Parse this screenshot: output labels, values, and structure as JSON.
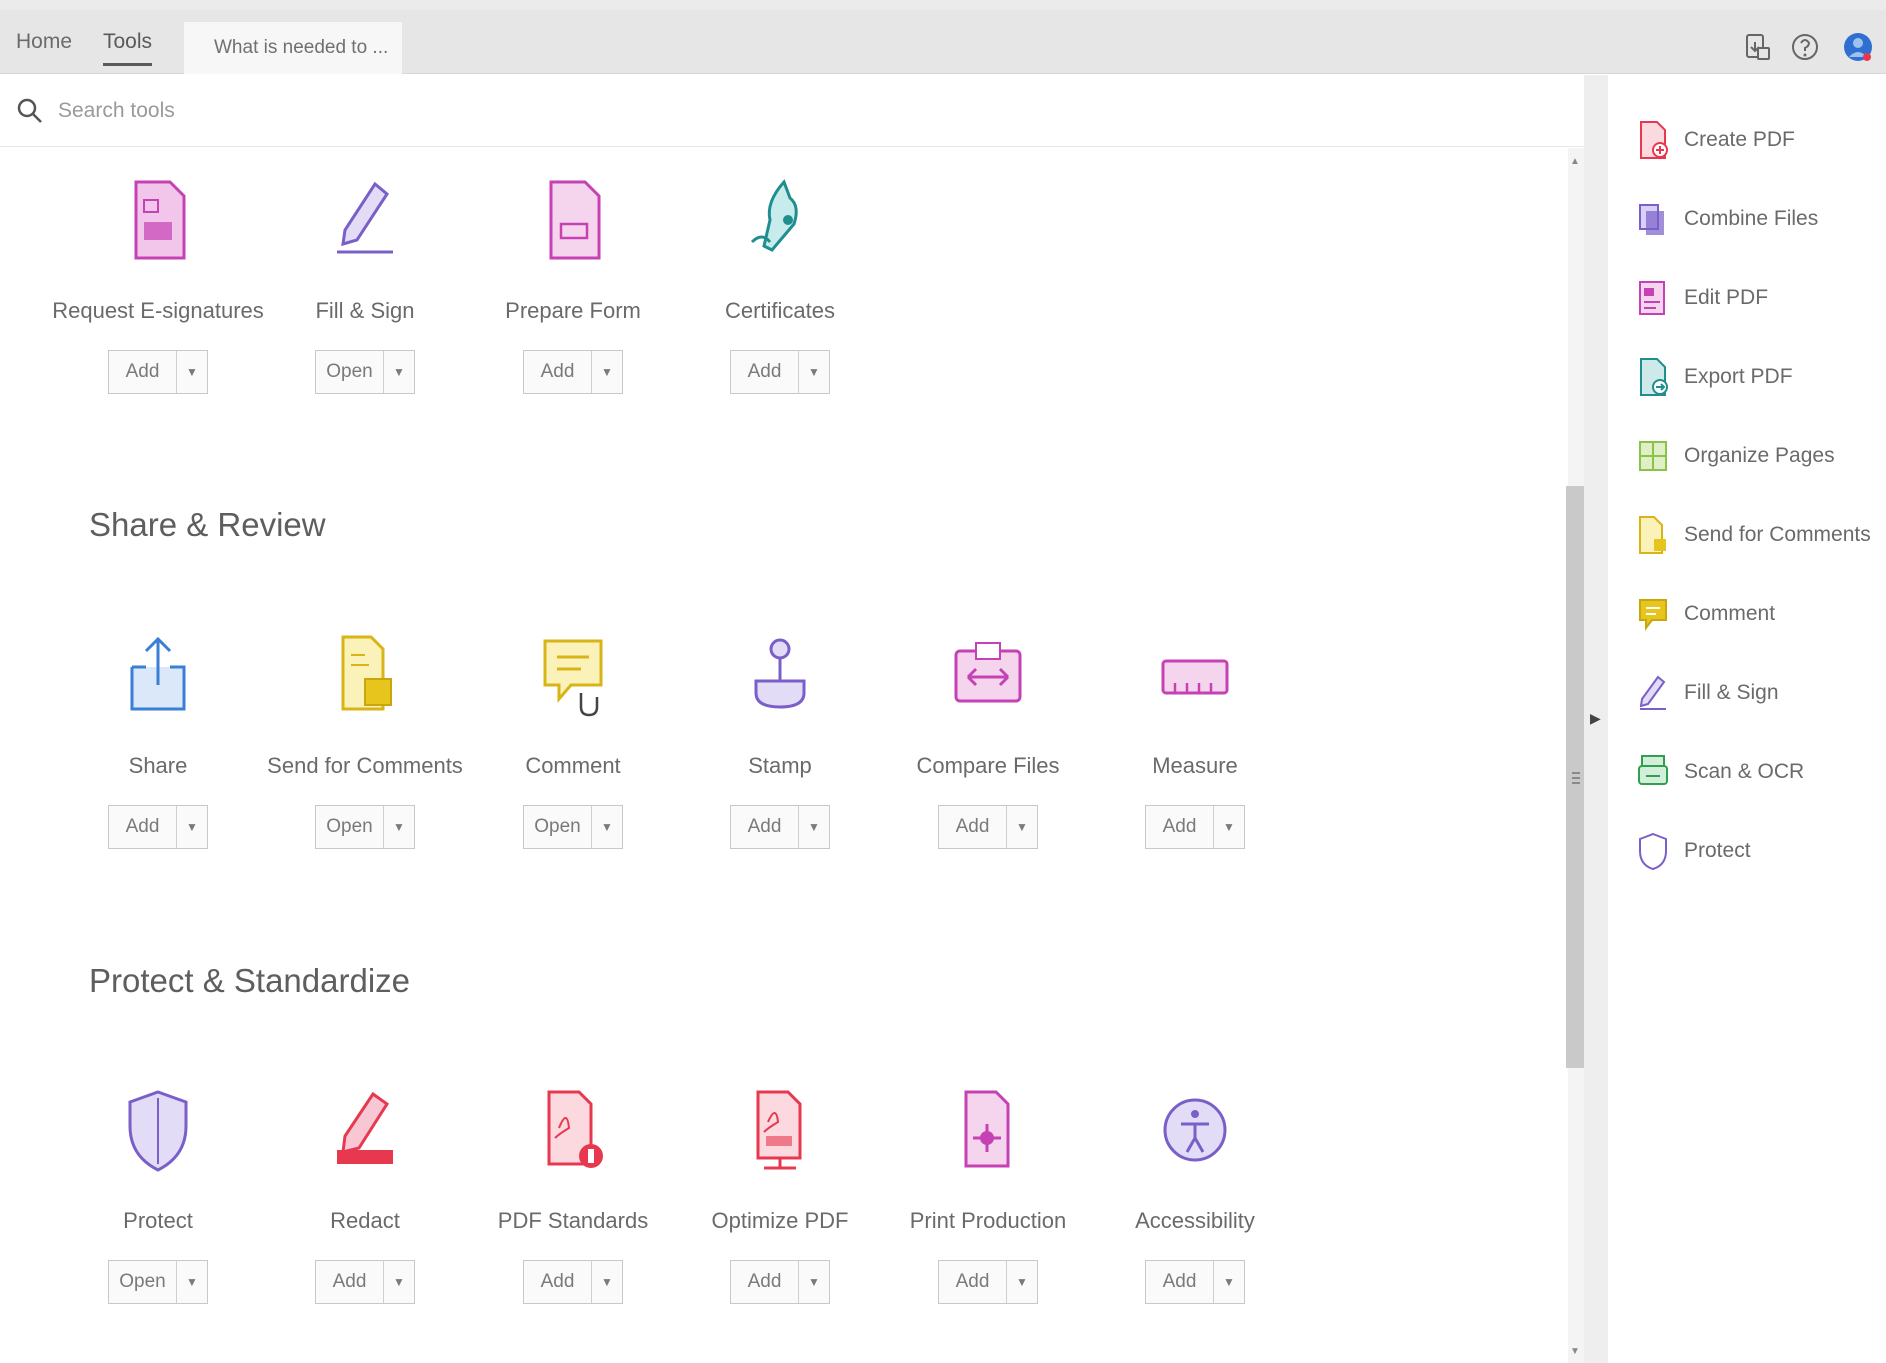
{
  "tabs": {
    "home": "Home",
    "tools": "Tools",
    "document": "What is needed to ..."
  },
  "search": {
    "placeholder": "Search tools"
  },
  "sections": [
    {
      "title": "",
      "tools": [
        {
          "name": "Request E-signatures",
          "button": "Add",
          "icon": "request-esign-icon"
        },
        {
          "name": "Fill & Sign",
          "button": "Open",
          "icon": "fill-sign-icon"
        },
        {
          "name": "Prepare Form",
          "button": "Add",
          "icon": "prepare-form-icon"
        },
        {
          "name": "Certificates",
          "button": "Add",
          "icon": "certificates-icon"
        }
      ]
    },
    {
      "title": "Share & Review",
      "tools": [
        {
          "name": "Share",
          "button": "Add",
          "icon": "share-icon"
        },
        {
          "name": "Send for Comments",
          "button": "Open",
          "icon": "send-comments-icon"
        },
        {
          "name": "Comment",
          "button": "Open",
          "icon": "comment-icon"
        },
        {
          "name": "Stamp",
          "button": "Add",
          "icon": "stamp-icon"
        },
        {
          "name": "Compare Files",
          "button": "Add",
          "icon": "compare-files-icon"
        },
        {
          "name": "Measure",
          "button": "Add",
          "icon": "measure-icon"
        }
      ]
    },
    {
      "title": "Protect & Standardize",
      "tools": [
        {
          "name": "Protect",
          "button": "Open",
          "icon": "protect-icon"
        },
        {
          "name": "Redact",
          "button": "Add",
          "icon": "redact-icon"
        },
        {
          "name": "PDF Standards",
          "button": "Add",
          "icon": "pdf-standards-icon"
        },
        {
          "name": "Optimize PDF",
          "button": "Add",
          "icon": "optimize-pdf-icon"
        },
        {
          "name": "Print Production",
          "button": "Add",
          "icon": "print-production-icon"
        },
        {
          "name": "Accessibility",
          "button": "Add",
          "icon": "accessibility-icon"
        }
      ]
    }
  ],
  "right_panel": [
    {
      "label": "Create PDF",
      "icon": "create-pdf-icon"
    },
    {
      "label": "Combine Files",
      "icon": "combine-files-icon"
    },
    {
      "label": "Edit PDF",
      "icon": "edit-pdf-icon"
    },
    {
      "label": "Export PDF",
      "icon": "export-pdf-icon"
    },
    {
      "label": "Organize Pages",
      "icon": "organize-pages-icon"
    },
    {
      "label": "Send for Comments",
      "icon": "send-comments-icon"
    },
    {
      "label": "Comment",
      "icon": "comment-icon"
    },
    {
      "label": "Fill & Sign",
      "icon": "fill-sign-icon"
    },
    {
      "label": "Scan & OCR",
      "icon": "scan-ocr-icon"
    },
    {
      "label": "Protect",
      "icon": "protect-icon"
    }
  ],
  "colors": {
    "tab_bar": "#e6e6e6",
    "pink": "#d1378e",
    "purple": "#7a5fc9",
    "teal": "#1e8e8e",
    "blue": "#3a7fd6",
    "yellow": "#e7c51c",
    "red": "#e8384f",
    "green": "#2ea04f",
    "olive": "#8bc34a"
  }
}
